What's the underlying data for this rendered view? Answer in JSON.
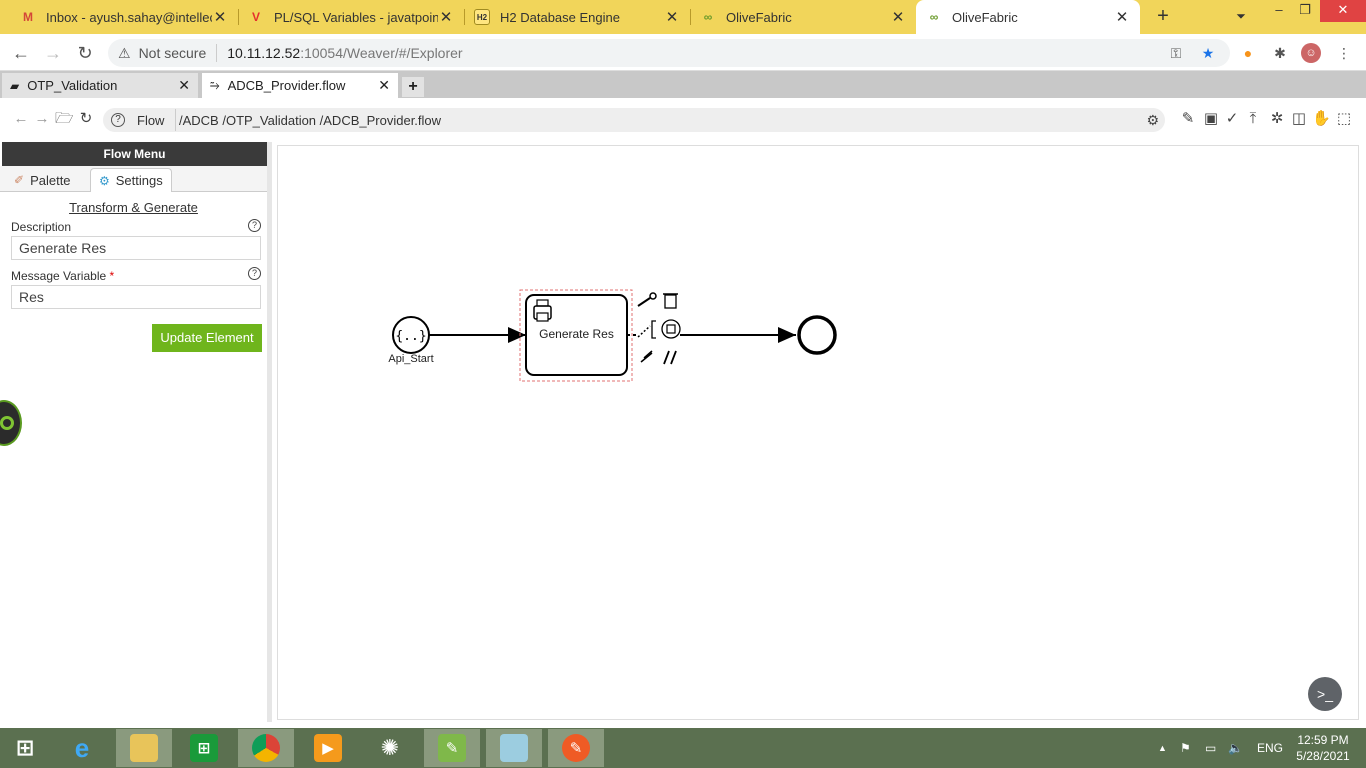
{
  "browser": {
    "tabs": [
      {
        "title": "Inbox - ayush.sahay@intellect",
        "favicon": "M"
      },
      {
        "title": "PL/SQL Variables - javatpoint",
        "favicon": "V"
      },
      {
        "title": "H2 Database Engine",
        "favicon": "H2"
      },
      {
        "title": "OliveFabric",
        "favicon": "olive-icon"
      },
      {
        "title": "OliveFabric",
        "favicon": "olive-icon"
      }
    ],
    "security_text": "Not secure",
    "url_host": "10.11.12.52",
    "url_path": ":10054/Weaver/#/Explorer"
  },
  "app_tabs": [
    {
      "label": "OTP_Validation"
    },
    {
      "label": "ADCB_Provider.flow"
    }
  ],
  "toolbar": {
    "flow_label": "Flow",
    "path": "/ADCB /OTP_Validation /ADCB_Provider.flow"
  },
  "panel": {
    "header": "Flow Menu",
    "tab_palette": "Palette",
    "tab_settings": "Settings",
    "section_title": "Transform & Generate",
    "description_label": "Description",
    "description_value": "Generate Res",
    "message_label": "Message Variable",
    "message_required": "*",
    "message_value": "Res",
    "update_button": "Update Element"
  },
  "flow": {
    "start_label": "Api_Start",
    "task_label": "Generate Res"
  },
  "taskbar": {
    "language": "ENG",
    "time": "12:59 PM",
    "date": "5/28/2021"
  },
  "colors": {
    "chrome_tabstrip": "#f1d55a",
    "update_button": "#6fb51c",
    "taskbar": "#5b7050"
  }
}
